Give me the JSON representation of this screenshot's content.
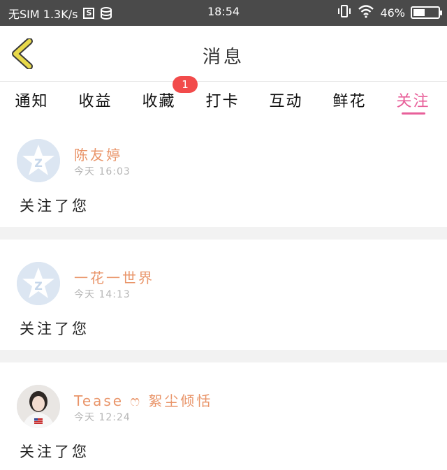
{
  "status_bar": {
    "carrier": "无SIM 1.3K/s",
    "sim_icon_text": "S",
    "time": "18:54",
    "battery": "46%",
    "battery_level": 0.46,
    "icons": [
      "sim-card-icon",
      "database-icon",
      "vibrate-icon",
      "wifi-icon",
      "battery-icon"
    ]
  },
  "header": {
    "title": "消息",
    "back_icon": "chevron-left-icon"
  },
  "tabs": [
    {
      "label": "通知"
    },
    {
      "label": "收益"
    },
    {
      "label": "收藏",
      "badge": "1"
    },
    {
      "label": "打卡"
    },
    {
      "label": "互动"
    },
    {
      "label": "鲜花"
    },
    {
      "label": "关注",
      "active": true
    }
  ],
  "messages": [
    {
      "user": "陈友婷",
      "time": "今天 16:03",
      "text": "关注了您",
      "avatar": "qzone-default-avatar"
    },
    {
      "user": "一花一世界",
      "time": "今天 14:13",
      "text": "关注了您",
      "avatar": "qzone-default-avatar"
    },
    {
      "user": "Tease ෆ 絮尘倾恬",
      "time": "今天 12:24",
      "text": "关注了您",
      "avatar": "user-photo-avatar"
    }
  ],
  "colors": {
    "accent": "#e8609a",
    "name": "#e9956a",
    "badge": "#f24b4b",
    "status_bar": "#4a4a4a",
    "back_icon": "#e8d94a"
  }
}
